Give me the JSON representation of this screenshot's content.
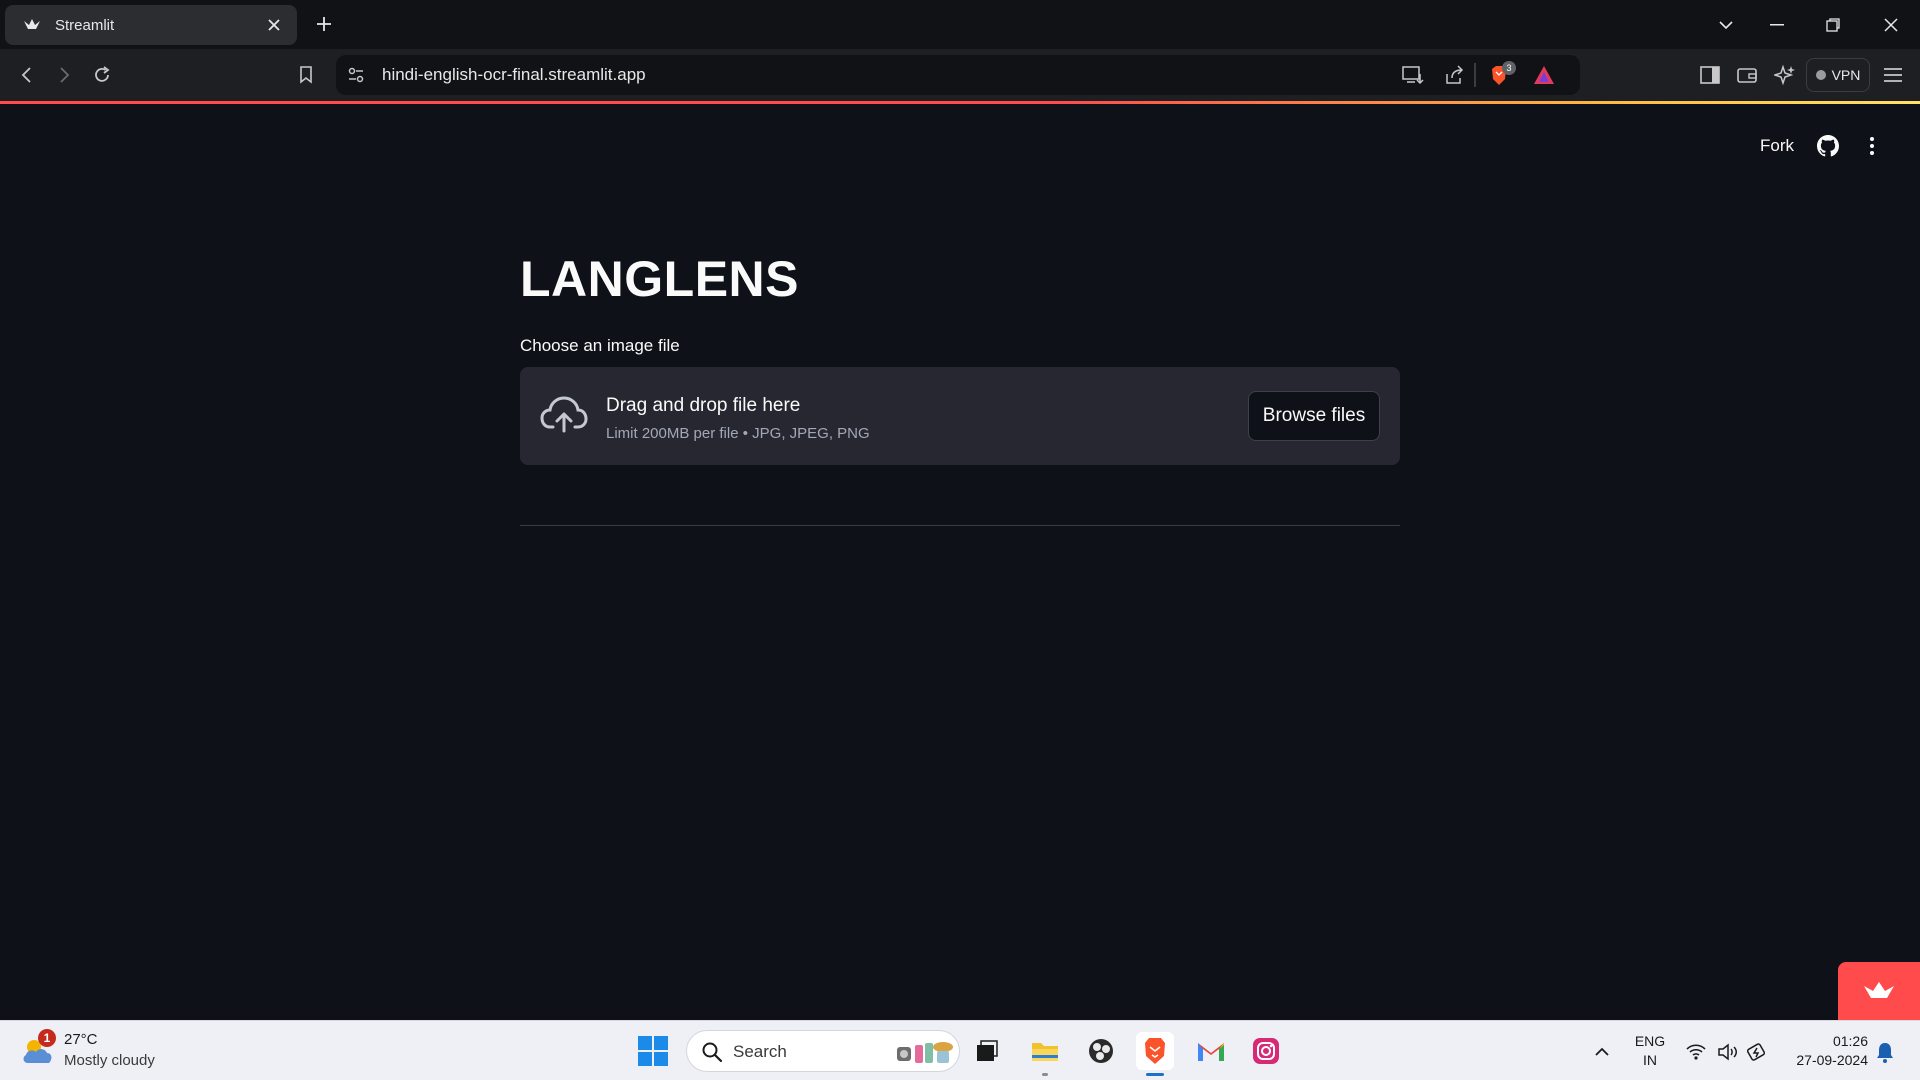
{
  "browser": {
    "tab_title": "Streamlit",
    "url": "hindi-english-ocr-final.streamlit.app",
    "vpn_label": "VPN",
    "shields_count": "3"
  },
  "app": {
    "fork_label": "Fork",
    "title": "LANGLENS",
    "uploader": {
      "label": "Choose an image file",
      "drop_text": "Drag and drop file here",
      "limit_text": "Limit 200MB per file • JPG, JPEG, PNG",
      "browse_label": "Browse files"
    },
    "colors": {
      "accent": "#ff4b4b",
      "background": "#0e1117",
      "dropzone": "#262730"
    }
  },
  "taskbar": {
    "weather_badge": "1",
    "temperature": "27°C",
    "condition": "Mostly cloudy",
    "search_placeholder": "Search",
    "lang_line1": "ENG",
    "lang_line2": "IN",
    "time": "01:26",
    "date": "27-09-2024"
  }
}
